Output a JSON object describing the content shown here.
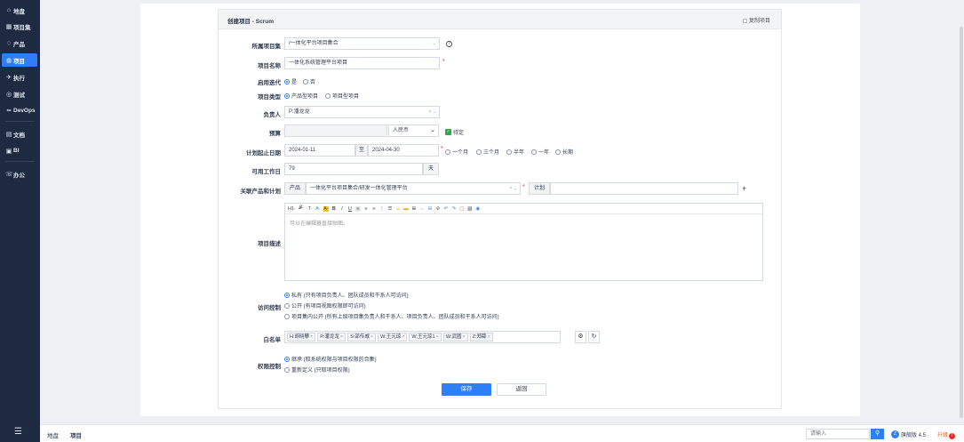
{
  "nav": {
    "items": [
      {
        "label": "地盘",
        "icon": "home-icon",
        "glyph": "⌂"
      },
      {
        "label": "项目集",
        "icon": "program-icon",
        "glyph": "▦"
      },
      {
        "label": "产品",
        "icon": "product-icon",
        "glyph": "♢"
      },
      {
        "label": "项目",
        "icon": "project-icon",
        "glyph": "◍"
      },
      {
        "label": "执行",
        "icon": "execution-icon",
        "glyph": "✈"
      },
      {
        "label": "测试",
        "icon": "test-icon",
        "glyph": "◎"
      },
      {
        "label": "DevOps",
        "icon": "devops-icon",
        "glyph": "∞"
      },
      {
        "label": "文档",
        "icon": "doc-icon",
        "glyph": "▤"
      },
      {
        "label": "BI",
        "icon": "bi-icon",
        "glyph": "▣"
      },
      {
        "label": "办公",
        "icon": "office-icon",
        "glyph": "☏"
      }
    ],
    "active_index": 3,
    "menu_icon": "☰"
  },
  "breadcrumb": {
    "home": "地盘",
    "current": "项目"
  },
  "footer": {
    "search_placeholder": "请输入",
    "search_icon": "⚲",
    "version": "旗舰版 4.5",
    "upgrade": "升级"
  },
  "panel": {
    "title": "创建项目 - Scrum",
    "copy": "复制项目"
  },
  "form": {
    "program_label": "所属项目集",
    "program_value": "/一体化平台项目集合",
    "name_label": "项目名称",
    "name_value": "一体化系统管理平台项目",
    "iteration_label": "启用迭代",
    "iteration_yes": "是",
    "iteration_no": "否",
    "type_label": "项目类型",
    "type_product": "产品型项目",
    "type_project": "项目型项目",
    "owner_label": "负责人",
    "owner_value": "P:潘龙龙",
    "budget_label": "预算",
    "budget_currency": "人民币",
    "budget_tbd": "待定",
    "dates_label": "计划起止日期",
    "date_begin": "2024-01-11",
    "date_to": "至",
    "date_end": "2024-04-30",
    "durations": [
      "一个月",
      "三个月",
      "半年",
      "一年",
      "长期"
    ],
    "workdays_label": "可用工作日",
    "workdays_value": "79",
    "workdays_unit": "天",
    "products_label": "关联产品和计划",
    "product_addon": "产品",
    "product_value": "一体化平台项目集合/研发一体化管理平台",
    "plan_addon": "计划",
    "desc_label": "项目描述",
    "desc_placeholder": "可以在编辑器直接贴图。",
    "toolbar": [
      "H1·",
      "𝓕·",
      "·T·",
      "A·",
      "A·",
      "B",
      "I",
      "U",
      "≡",
      "≡",
      "≡",
      "⋮",
      "☰",
      "☺",
      "▬",
      "⊞",
      "⇔",
      "⊟",
      "⊘",
      "↶",
      "↷",
      "▢",
      "▧",
      "◉"
    ],
    "acl_label": "访问控制",
    "acl_options": [
      "私有 (只有项目负责人、团队成员和干系人可访问)",
      "公开 (有项目视图权限即可访问)",
      "项目集内公开 (所有上级项目集负责人和干系人、项目负责人、团队成员和干系人可访问)"
    ],
    "whitelist_label": "白名单",
    "whitelist": [
      "H:胡晓攀",
      "P:潘龙龙",
      "S:邵传威",
      "W:王元琼",
      "W:王元琼1",
      "W:武圆",
      "Z:郑薛"
    ],
    "auth_label": "权限控制",
    "auth_options": [
      "继承 (取系统权限与项目权限的合集)",
      "重新定义 (只取项目权限)"
    ],
    "save": "保存",
    "back": "返回"
  },
  "colors": {
    "accent": "#2e7ff6",
    "sidebar": "#1e2a3f",
    "required": "#e03131",
    "tbd_check": "#2ca84b"
  }
}
